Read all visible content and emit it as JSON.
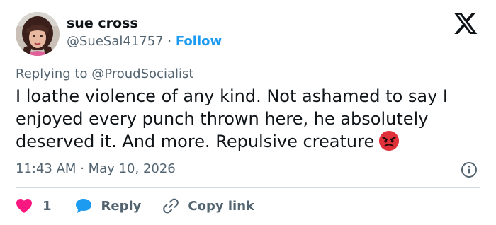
{
  "user": {
    "name": "sue cross",
    "handle": "@SueSal41757",
    "separator": "·",
    "follow_label": "Follow"
  },
  "logo_icon": "x-logo-icon",
  "reply_context": {
    "prefix": "Replying to",
    "target": "@ProudSocialist"
  },
  "tweet": {
    "text": "I loathe violence of any kind. Not ashamed to say I enjoyed every punch thrown here, he absolutely deserved it. And more. Repulsive creature",
    "emoji": "angry-face-emoji"
  },
  "meta": {
    "time": "11:43 AM",
    "separator": "·",
    "date": "May 10, 2026",
    "info_icon": "info-icon"
  },
  "actions": {
    "like_count": "1",
    "reply_label": "Reply",
    "copy_link_label": "Copy link"
  },
  "colors": {
    "accent": "#1d9bf0",
    "like": "#f91880",
    "secondary_text": "#536471",
    "divider": "#cfd9de"
  }
}
